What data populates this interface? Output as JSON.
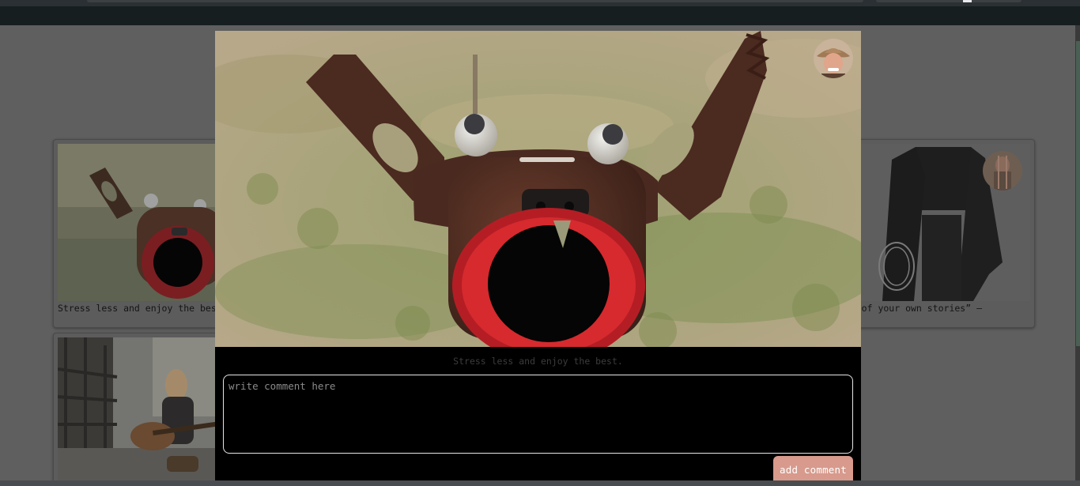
{
  "gallery": {
    "cards": [
      {
        "caption": "Stress less and enjoy the best."
      },
      {
        "caption": ""
      },
      {
        "caption": "Be the hero of your own stories” –"
      }
    ]
  },
  "modal": {
    "caption": "Stress less and enjoy the best.",
    "comment": {
      "placeholder": "write comment here",
      "value": ""
    },
    "add_comment_label": "add comment"
  },
  "icons": {
    "user_avatar": "cowboy-avatar",
    "card_avatar": "user-avatar"
  },
  "colors": {
    "header_bg": "#171e1f",
    "modal_bg": "#000000",
    "button_bg": "#d79a8c",
    "backdrop": "#5f5f5f"
  }
}
